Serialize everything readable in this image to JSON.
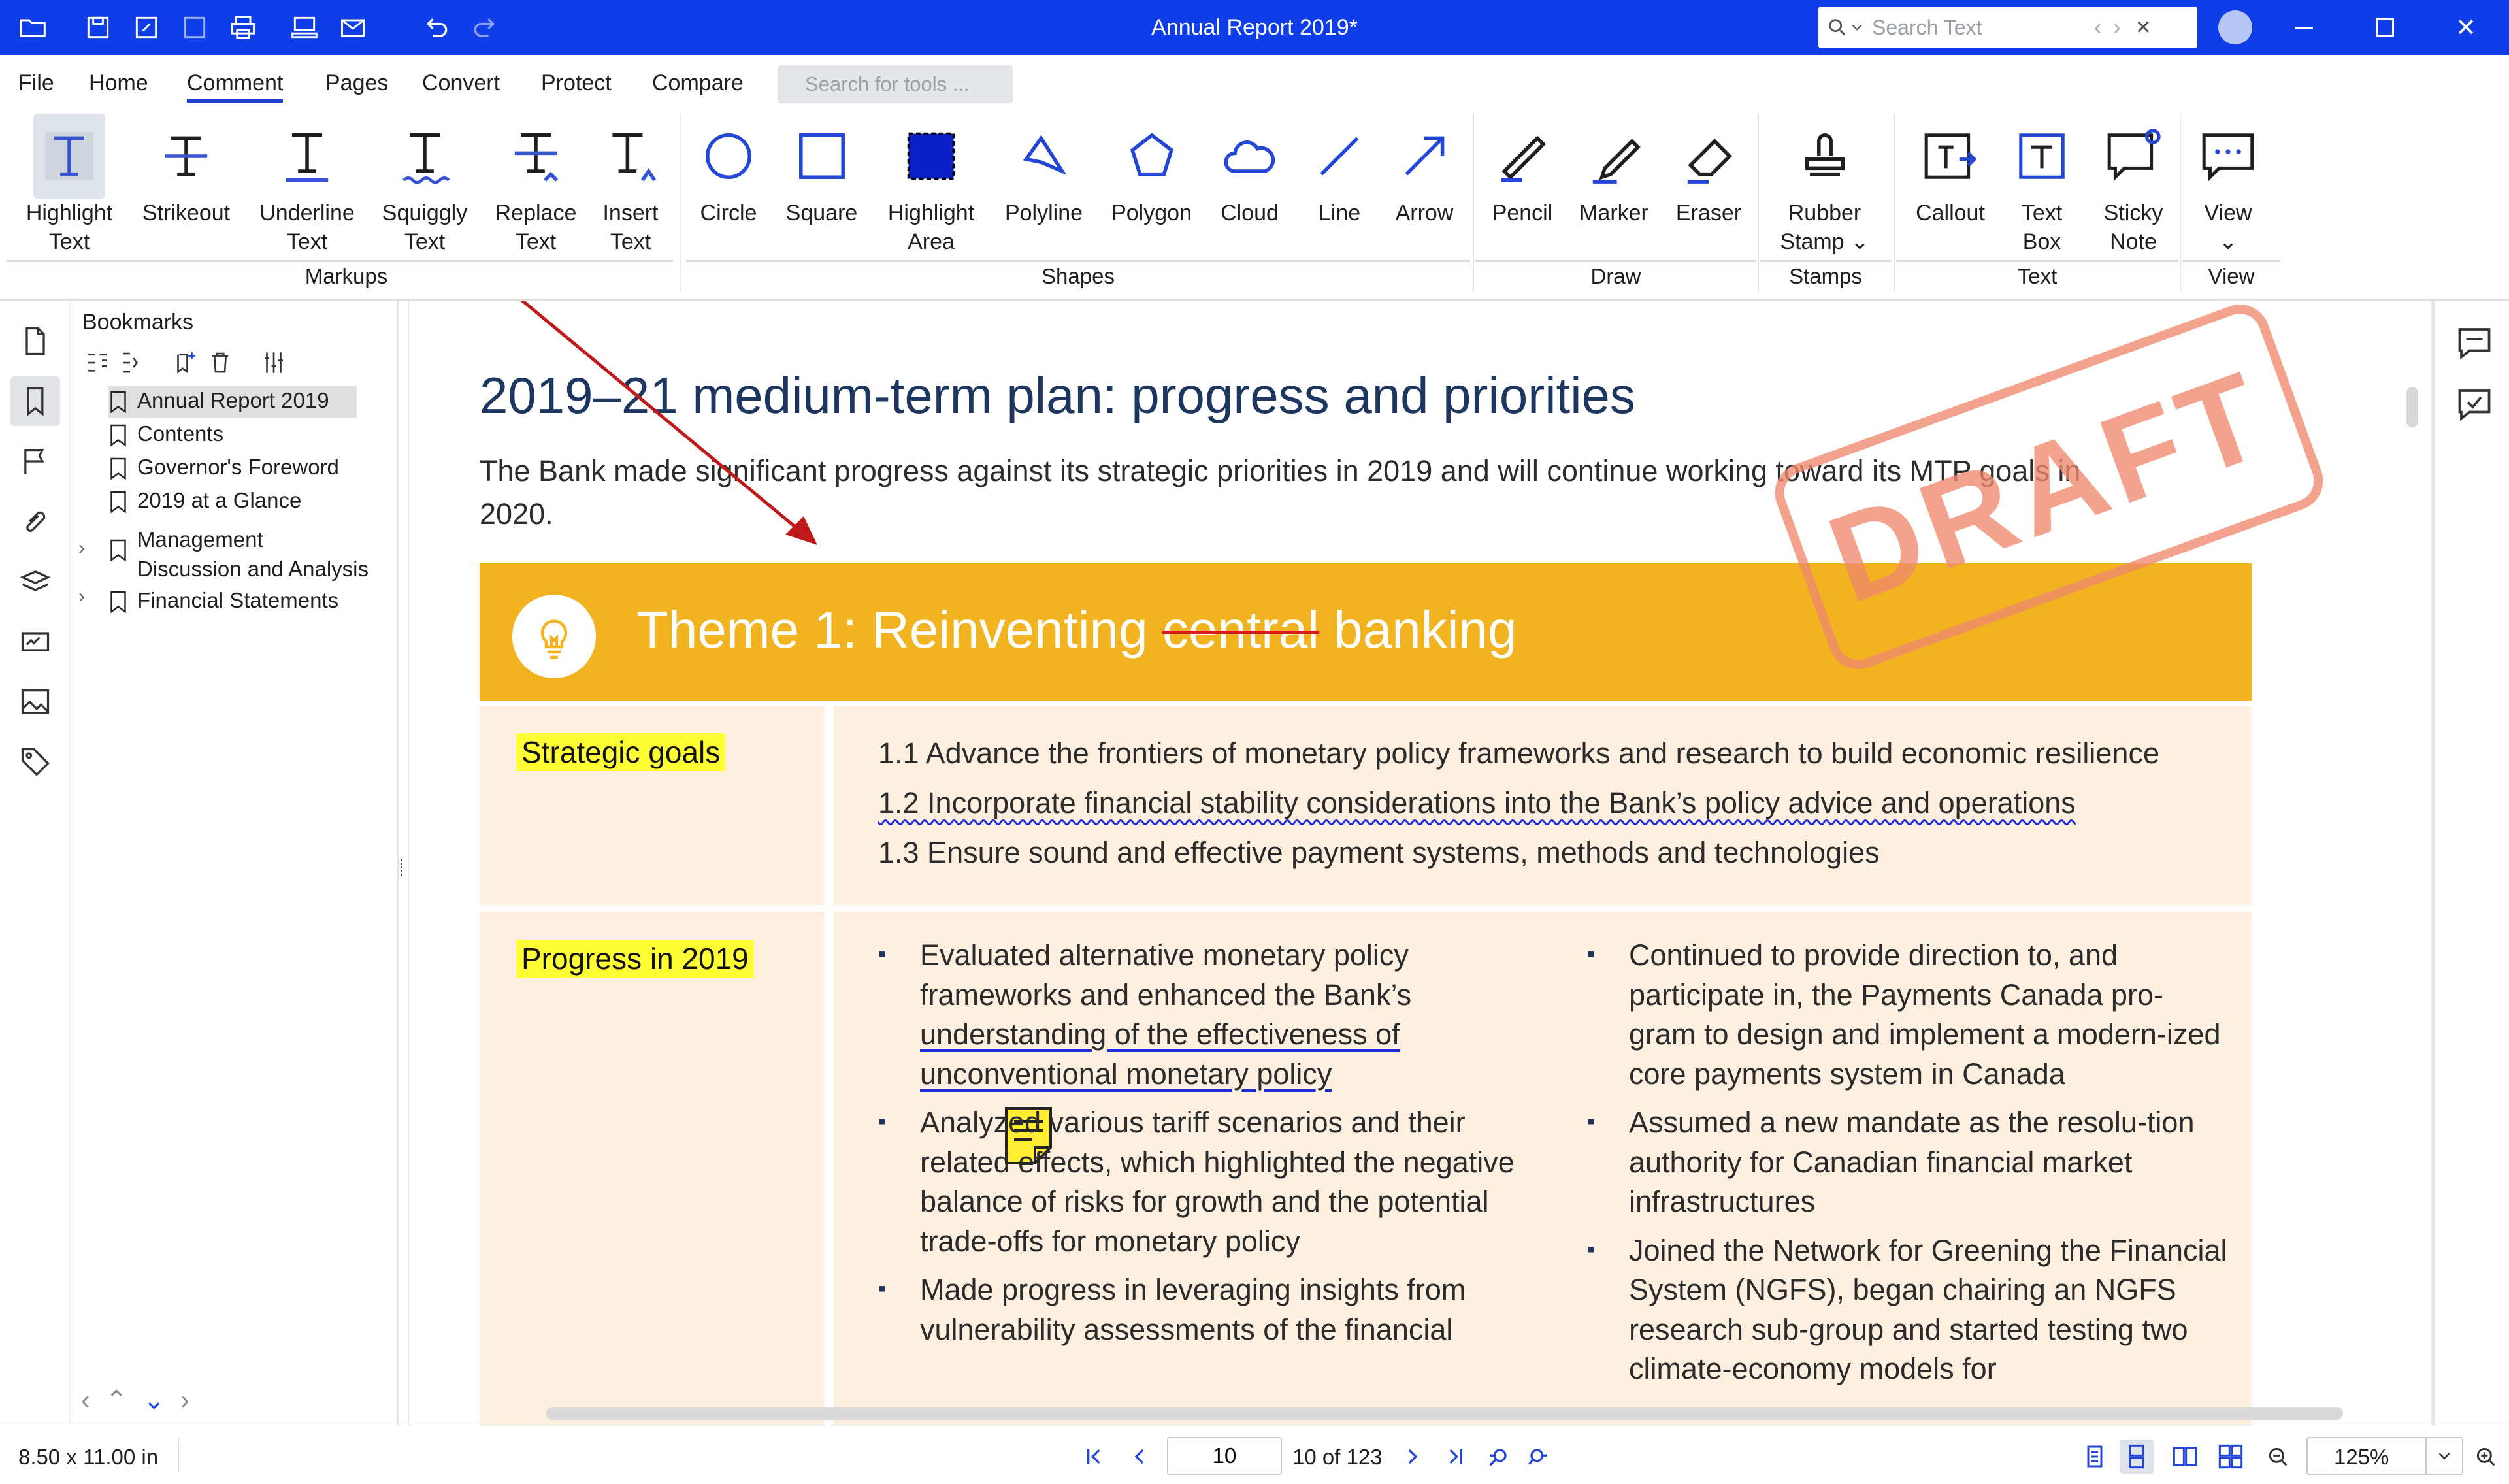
{
  "window": {
    "title": "Annual Report 2019*",
    "search_placeholder": "Search Text"
  },
  "menu": {
    "items": [
      "File",
      "Home",
      "Comment",
      "Pages",
      "Convert",
      "Protect",
      "Compare"
    ],
    "active": "Comment",
    "tool_search_placeholder": "Search for tools ..."
  },
  "ribbon": {
    "tools": [
      {
        "label": "Highlight\nText",
        "icon": "highlight-text-icon"
      },
      {
        "label": "Strikeout",
        "icon": "strikeout-icon"
      },
      {
        "label": "Underline\nText",
        "icon": "underline-icon"
      },
      {
        "label": "Squiggly\nText",
        "icon": "squiggly-icon"
      },
      {
        "label": "Replace\nText",
        "icon": "replace-text-icon"
      },
      {
        "label": "Insert\nText",
        "icon": "insert-text-icon"
      },
      {
        "label": "Circle",
        "icon": "circle-icon"
      },
      {
        "label": "Square",
        "icon": "square-icon"
      },
      {
        "label": "Highlight\nArea",
        "icon": "highlight-area-icon"
      },
      {
        "label": "Polyline",
        "icon": "polyline-icon"
      },
      {
        "label": "Polygon",
        "icon": "polygon-icon"
      },
      {
        "label": "Cloud",
        "icon": "cloud-icon"
      },
      {
        "label": "Line",
        "icon": "line-icon"
      },
      {
        "label": "Arrow",
        "icon": "arrow-icon"
      },
      {
        "label": "Pencil",
        "icon": "pencil-icon"
      },
      {
        "label": "Marker",
        "icon": "marker-icon"
      },
      {
        "label": "Eraser",
        "icon": "eraser-icon"
      },
      {
        "label": "Rubber\nStamp ⌄",
        "icon": "rubber-stamp-icon"
      },
      {
        "label": "Callout",
        "icon": "callout-icon"
      },
      {
        "label": "Text\nBox",
        "icon": "text-box-icon"
      },
      {
        "label": "Sticky\nNote",
        "icon": "sticky-note-icon"
      },
      {
        "label": "View\n⌄",
        "icon": "view-comments-icon"
      }
    ],
    "groups": [
      "Markups",
      "Shapes",
      "Draw",
      "Stamps",
      "Text",
      "View"
    ]
  },
  "bookmarks": {
    "title": "Bookmarks",
    "items": [
      {
        "label": "Annual Report 2019",
        "selected": true
      },
      {
        "label": "Contents"
      },
      {
        "label": "Governor's Foreword"
      },
      {
        "label": "2019 at a Glance"
      },
      {
        "label": "Management\nDiscussion and Analysis",
        "expandable": true
      },
      {
        "label": "Financial Statements",
        "expandable": true
      }
    ]
  },
  "document": {
    "heading": "2019–21 medium-term plan: progress and priorities",
    "intro": "The Bank made significant progress against its strategic priorities in 2019 and will continue working toward its MTP goals in 2020.",
    "theme": {
      "prefix": "Theme 1: Reinventing ",
      "struck": "central",
      "suffix": " banking"
    },
    "goals_label": "Strategic goals",
    "goals": [
      "1.1 Advance the frontiers of monetary policy frameworks and research to build economic resilience",
      "1.2 Incorporate financial stability considerations into the Bank’s policy advice and operations",
      "1.3 Ensure sound and effective payment systems, methods and technologies"
    ],
    "progress_label": "Progress in 2019",
    "progress_left": [
      {
        "pre": "Evaluated alternative monetary policy frameworks and enhanced the Bank’s ",
        "underlined": "understanding of the effectiveness of unconventional monetary policy",
        "post": ""
      },
      {
        "pre": "Analyzed various tariff scenarios and their related effects, which highlighted the negative balance of risks for growth and the potential trade-offs for monetary policy",
        "underlined": "",
        "post": ""
      },
      {
        "pre": "Made progress in leveraging insights from vulnerability assessments of the financial",
        "underlined": "",
        "post": ""
      }
    ],
    "progress_right": [
      "Continued to provide direction to, and participate in, the Payments Canada pro-gram to design and implement a modern-ized core payments system in Canada",
      "Assumed a new mandate as the resolu-tion authority for Canadian financial market infrastructures",
      "Joined the Network for Greening the Financial System (NGFS), began chairing an NGFS research sub-group and started testing two climate-economy models for"
    ],
    "stamp": "DRAFT"
  },
  "status": {
    "page_size": "8.50 x 11.00 in",
    "current_page": "10",
    "page_count": "10 of 123",
    "zoom": "125%"
  },
  "colors": {
    "titlebar": "#0f3ee8",
    "theme_band": "#f1b31f",
    "row_bg": "#fdf0e0",
    "label_highlight": "#ffff35",
    "stamp": "#f08a6e",
    "arrow": "#c0191a"
  }
}
